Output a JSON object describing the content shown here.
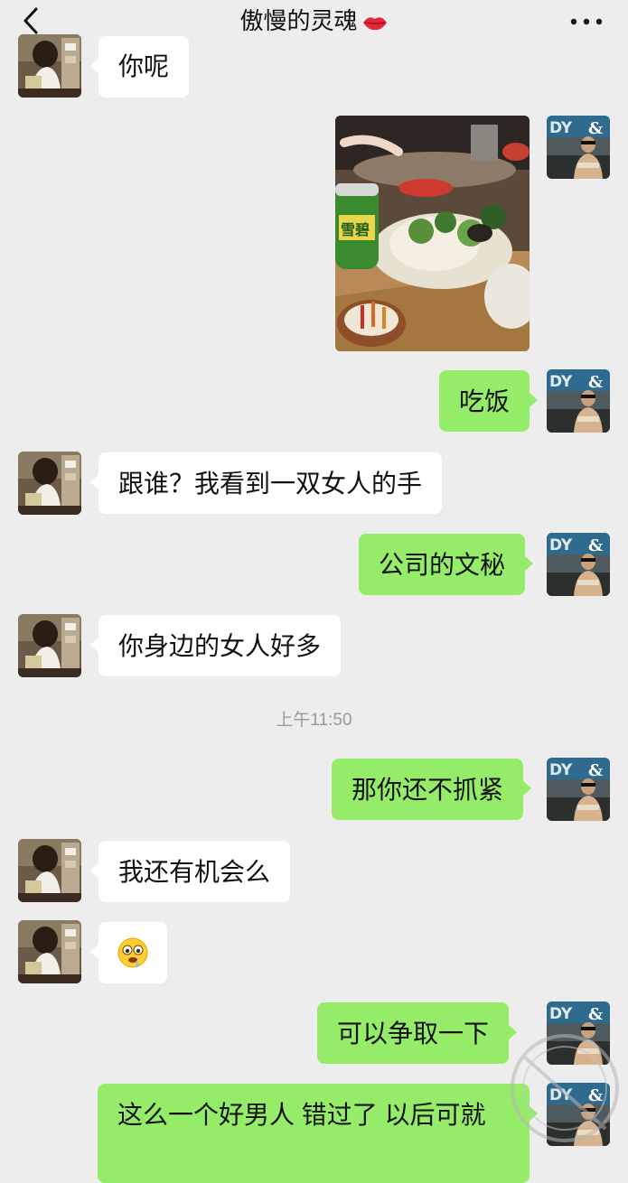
{
  "header": {
    "title": "傲慢的灵魂",
    "back_icon": "chevron-left-icon",
    "title_emoji": "kiss-lips-icon",
    "more_icon": "more-dots-icon"
  },
  "messages": [
    {
      "side": "in",
      "text": "你呢"
    },
    {
      "side": "out",
      "type": "image",
      "image_desc": "hotpot-photo"
    },
    {
      "side": "out",
      "text": "吃饭"
    },
    {
      "side": "in",
      "text": "跟谁？我看到一双女人的手"
    },
    {
      "side": "out",
      "text": "公司的文秘"
    },
    {
      "side": "in",
      "text": "你身边的女人好多"
    },
    {
      "side": "out",
      "text": "那你还不抓紧"
    },
    {
      "side": "in",
      "text": "我还有机会么"
    },
    {
      "side": "in",
      "type": "emoji",
      "emoji": "drooling-face-icon"
    },
    {
      "side": "out",
      "text": "可以争取一下"
    },
    {
      "side": "out",
      "text": "这么一个好男人 错过了 以后可就"
    }
  ],
  "timestamp": "上午11:50",
  "avatar_text": "DY",
  "can_text": "雪碧",
  "colors": {
    "background": "#ededed",
    "incoming_bubble": "#ffffff",
    "outgoing_bubble": "#95ec69",
    "timestamp_text": "#9a9a9a"
  }
}
